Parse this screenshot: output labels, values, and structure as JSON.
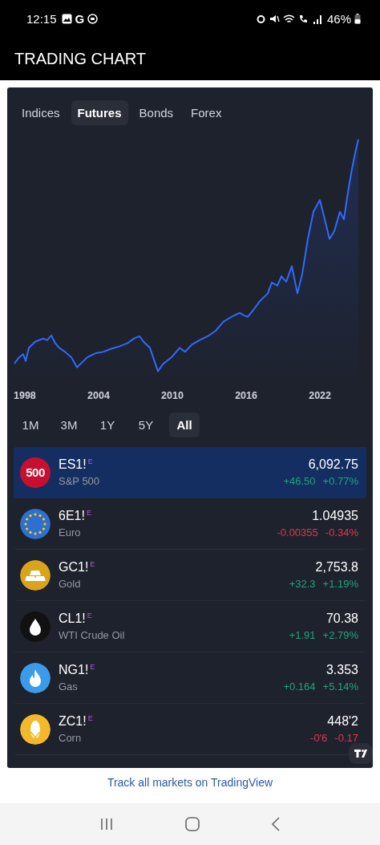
{
  "status_bar": {
    "time": "12:15",
    "app_letter": "G",
    "battery": "46%"
  },
  "app_bar": {
    "title": "TRADING CHART"
  },
  "tabs": [
    {
      "label": "Indices",
      "selected": false
    },
    {
      "label": "Futures",
      "selected": true
    },
    {
      "label": "Bonds",
      "selected": false
    },
    {
      "label": "Forex",
      "selected": false
    }
  ],
  "chart": {
    "kind": "picture",
    "x_labels": [
      "1998",
      "2004",
      "2010",
      "2016",
      "2022"
    ]
  },
  "ranges": [
    {
      "label": "1M",
      "selected": false
    },
    {
      "label": "3M",
      "selected": false
    },
    {
      "label": "1Y",
      "selected": false
    },
    {
      "label": "5Y",
      "selected": false
    },
    {
      "label": "All",
      "selected": true
    }
  ],
  "rows": [
    {
      "kind": "number",
      "icon_text": "500",
      "symbol": "ES1!",
      "mark": "E",
      "name": "S&P 500",
      "price": "6,092.75",
      "change": "+46.50",
      "change_pct": "+0.77%",
      "color": "#22a37a",
      "selected": true
    },
    {
      "kind": "euro",
      "symbol": "6E1!",
      "mark": "E",
      "name": "Euro",
      "price": "1.04935",
      "change": "-0.00355",
      "change_pct": "-0.34%",
      "color": "#e0394a",
      "selected": false
    },
    {
      "kind": "gold",
      "symbol": "GC1!",
      "mark": "E",
      "name": "Gold",
      "price": "2,753.8",
      "change": "+32.3",
      "change_pct": "+1.19%",
      "color": "#22a37a",
      "selected": false
    },
    {
      "kind": "oil",
      "symbol": "CL1!",
      "mark": "E",
      "name": "WTI Crude Oil",
      "price": "70.38",
      "change": "+1.91",
      "change_pct": "+2.79%",
      "color": "#22a37a",
      "selected": false
    },
    {
      "kind": "gas",
      "symbol": "NG1!",
      "mark": "E",
      "name": "Gas",
      "price": "3.353",
      "change": "+0.164",
      "change_pct": "+5.14%",
      "color": "#22a37a",
      "selected": false
    },
    {
      "kind": "corn",
      "symbol": "ZC1!",
      "mark": "E",
      "name": "Corn",
      "price": "448'2",
      "change": "-0'6",
      "change_pct": "-0.17",
      "color": "#e0394a",
      "selected": false
    }
  ],
  "footer_link": "Track all markets on TradingView"
}
